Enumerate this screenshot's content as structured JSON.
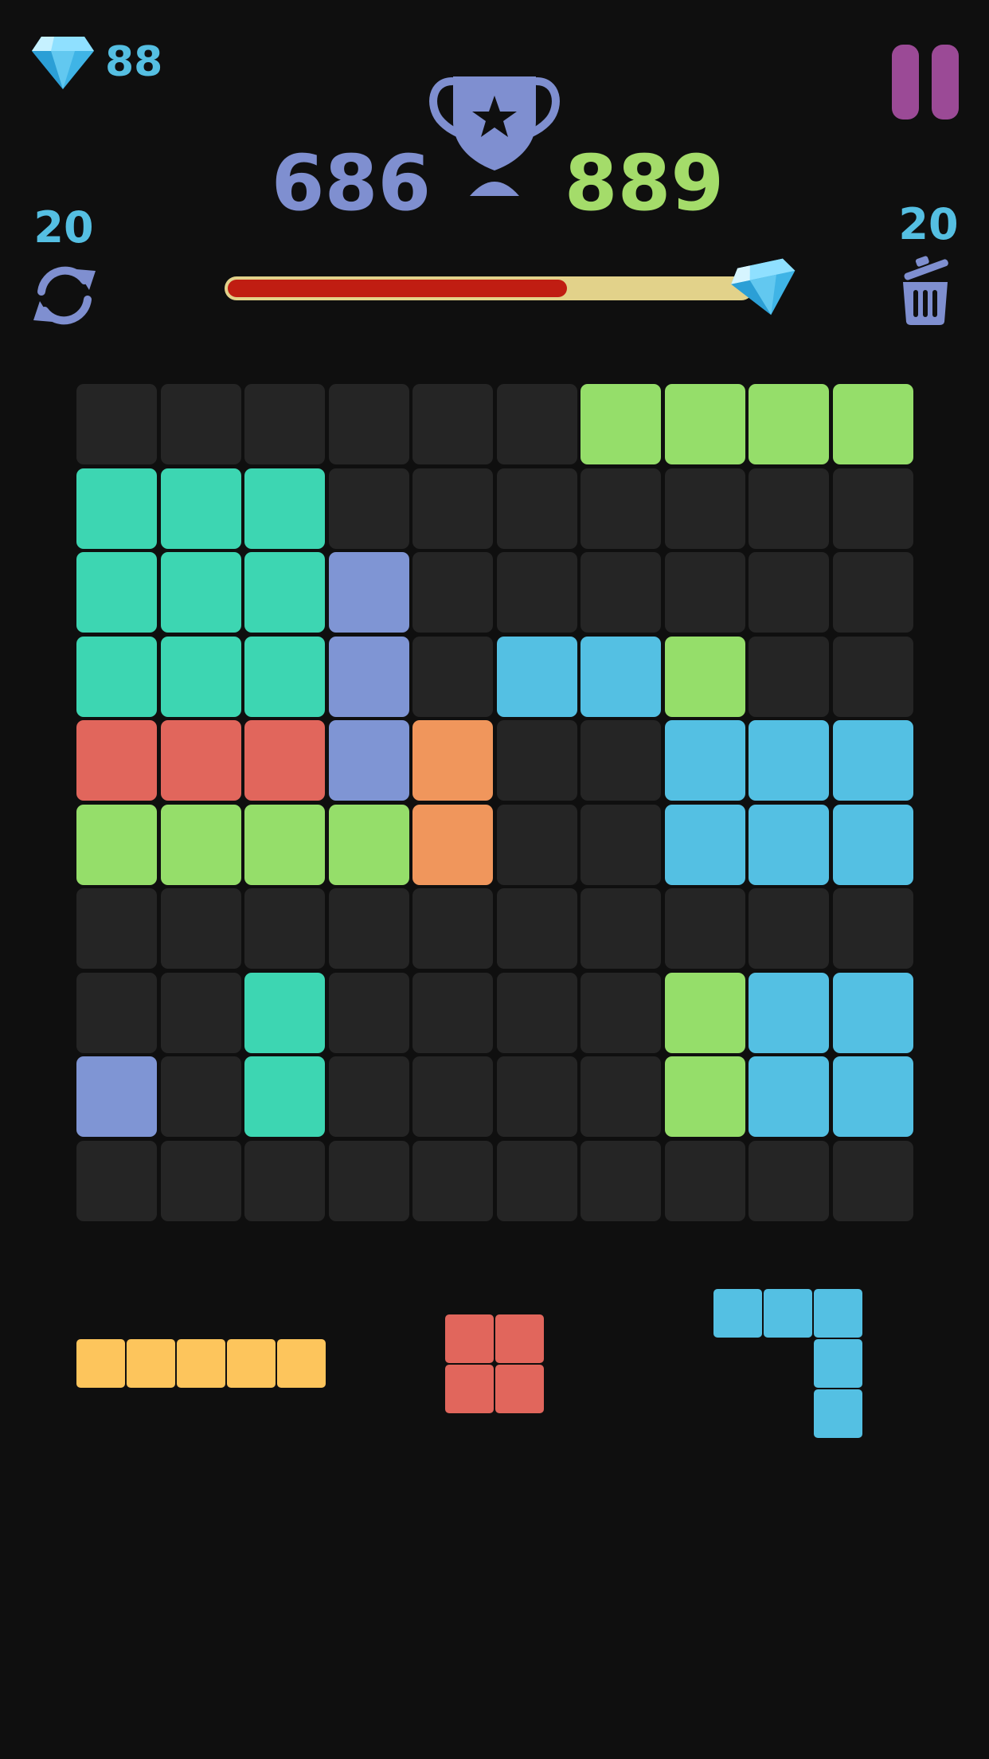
{
  "header": {
    "gems_count": "88",
    "current_score": "686",
    "best_score": "889",
    "refresh_count": "20",
    "trash_count": "20",
    "progress_fraction": 0.65
  },
  "colors": {
    "background": "#0f0f0f",
    "empty_cell": "#252525",
    "gem_text": "#55bfe2",
    "current_score": "#7f8fd0",
    "best_score": "#a4dc6a",
    "pause": "#9b4a96",
    "progress_track": "#e2d28a",
    "progress_fill": "#c01d12",
    "palette": {
      "G": "#95de6a",
      "T": "#3dd6b2",
      "P": "#7f95d4",
      "B": "#54c0e3",
      "R": "#e1665c",
      "O": "#f0965c",
      "Y": "#fdc55c"
    }
  },
  "icons": [
    "diamond-icon",
    "pause-icon",
    "trophy-icon",
    "refresh-icon",
    "trash-icon"
  ],
  "board": {
    "size": 10,
    "rows": [
      "......GGGG",
      "TTT.......",
      "TTTP......",
      "TTTP.BBG..",
      "RRRPO..BBB",
      "GGGGO..BBB",
      "..........",
      "..T....GBB",
      "P.T....GBB",
      ".........."
    ]
  },
  "tray": [
    {
      "color": "Y",
      "shape": [
        "YYYYY"
      ]
    },
    {
      "color": "R",
      "shape": [
        "RR",
        "RR"
      ]
    },
    {
      "color": "B",
      "shape": [
        "BBB",
        "..B",
        "..B"
      ]
    }
  ]
}
